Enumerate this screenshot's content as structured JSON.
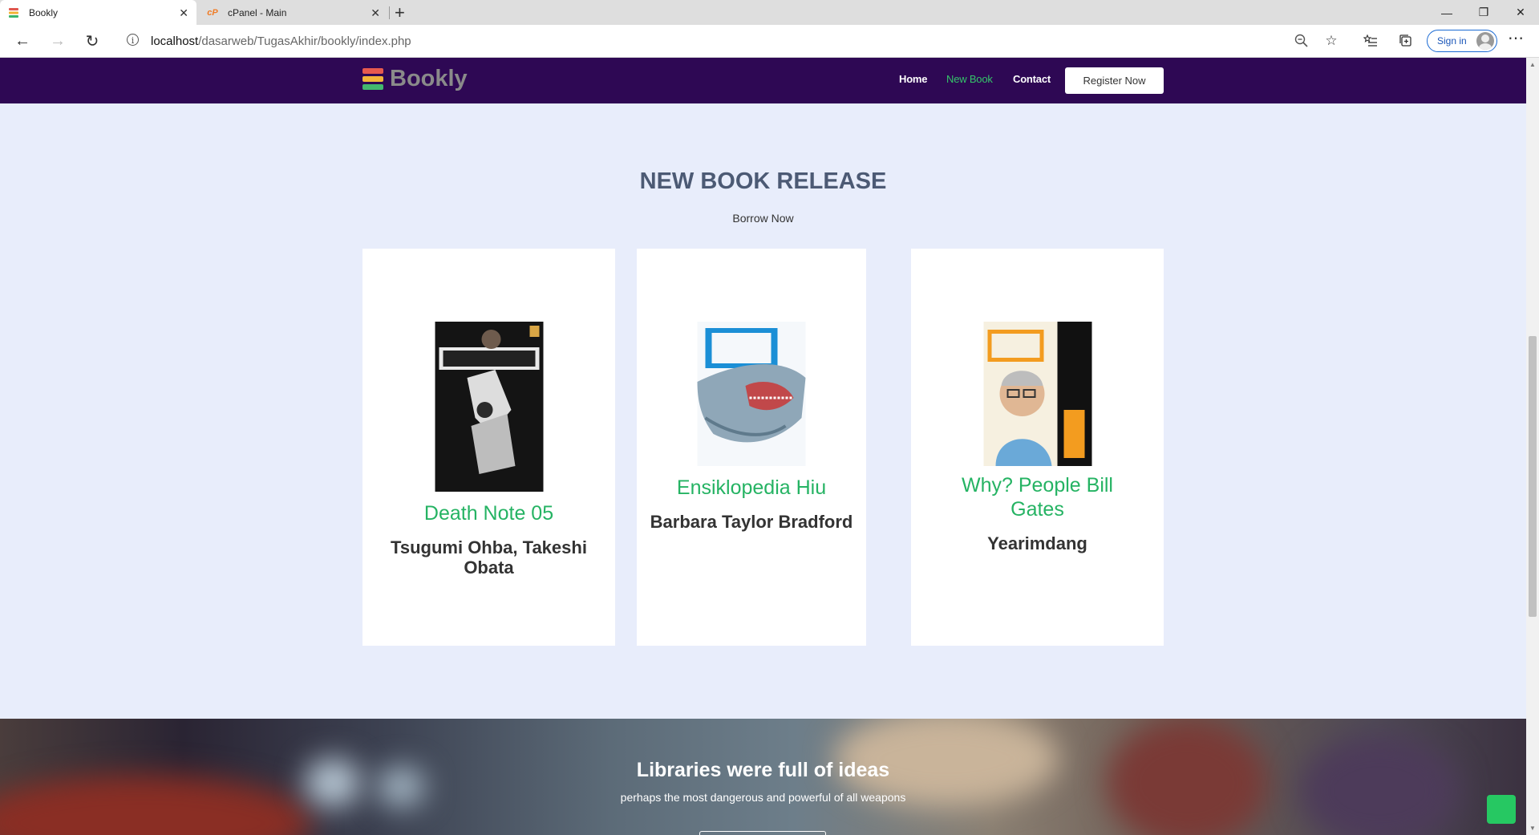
{
  "browser": {
    "tabs": [
      {
        "label": "Bookly",
        "active": true
      },
      {
        "label": "cPanel - Main",
        "active": false
      }
    ],
    "address": {
      "host": "localhost",
      "path": "/dasarweb/TugasAkhir/bookly/index.php"
    },
    "signin_label": "Sign in"
  },
  "site": {
    "logo_text": "Bookly",
    "nav": [
      {
        "label": "Home"
      },
      {
        "label": "New Book"
      },
      {
        "label": "Contact"
      }
    ],
    "register_label": "Register Now"
  },
  "section": {
    "title": "NEW BOOK RELEASE",
    "subtitle": "Borrow Now"
  },
  "books": [
    {
      "title": "Death Note 05",
      "author": "Tsugumi Ohba, Takeshi Obata"
    },
    {
      "title": "Ensiklopedia Hiu",
      "author": "Barbara Taylor Bradford"
    },
    {
      "title": "Why? People Bill Gates",
      "author": "Yearimdang"
    }
  ],
  "banner": {
    "title": "Libraries were full of ideas",
    "subtitle": "perhaps the most dangerous and powerful of all weapons"
  },
  "colors": {
    "navbar": "#2e0854",
    "accent": "#25b363",
    "page_bg": "#e8edfb"
  }
}
